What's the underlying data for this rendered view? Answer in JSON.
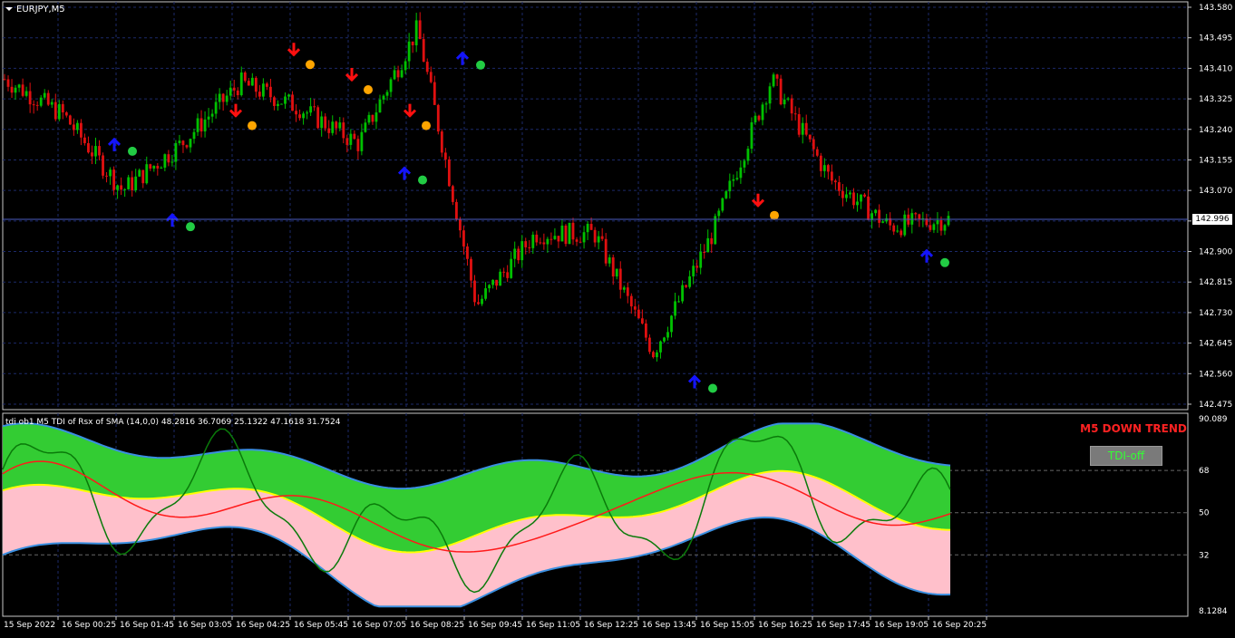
{
  "main_chart": {
    "symbol_label": "EURJPY,M5",
    "current_price": "142.996",
    "price_axis": [
      "143.580",
      "143.495",
      "143.410",
      "143.325",
      "143.240",
      "143.155",
      "143.070",
      "142.985",
      "142.900",
      "142.815",
      "142.730",
      "142.645",
      "142.560",
      "142.475"
    ],
    "colors": {
      "bull": "#00c000",
      "bear": "#e01010",
      "up_arrow": "#1414ff",
      "down_arrow": "#ff1010",
      "dot_green": "#22cc44",
      "dot_orange": "#ffa500",
      "grid": "#1c2a6a"
    }
  },
  "indicator": {
    "title": "tdi ob1 M5 TDI of Rsx of SMA (14,0,0) 48.2816 36.7069 25.1322 47.1618 31.7524",
    "axis_labels": [
      "90.089",
      "68",
      "50",
      "32",
      "8.1284"
    ],
    "trend_text": "M5 DOWN TREND",
    "toggle_button": "TDI-off",
    "colors": {
      "upper_fill": "#33cc33",
      "lower_fill": "#ffc0cb",
      "band_edge": "#3a8fe0",
      "mid": "#ffff00",
      "fast": "#0a7a0a",
      "slow": "#ff1a1a"
    }
  },
  "time_axis": [
    "15 Sep 2022",
    "16 Sep 00:25",
    "16 Sep 01:45",
    "16 Sep 03:05",
    "16 Sep 04:25",
    "16 Sep 05:45",
    "16 Sep 07:05",
    "16 Sep 08:25",
    "16 Sep 09:45",
    "16 Sep 11:05",
    "16 Sep 12:25",
    "16 Sep 13:45",
    "16 Sep 15:05",
    "16 Sep 16:25",
    "16 Sep 17:45",
    "16 Sep 19:05",
    "16 Sep 20:25"
  ],
  "chart_data": {
    "type": "line",
    "title": "EURJPY,M5",
    "ylim": [
      142.475,
      143.58
    ],
    "x": [
      "15 Sep 2022",
      "16 Sep 00:25",
      "16 Sep 01:45",
      "16 Sep 03:05",
      "16 Sep 04:25",
      "16 Sep 05:45",
      "16 Sep 07:05",
      "16 Sep 08:25",
      "16 Sep 09:45",
      "16 Sep 11:05",
      "16 Sep 12:25",
      "16 Sep 13:45",
      "16 Sep 15:05",
      "16 Sep 16:25",
      "16 Sep 17:45",
      "16 Sep 19:05",
      "16 Sep 20:25"
    ],
    "series": [
      {
        "values": [
          143.38,
          143.28,
          143.07,
          143.2,
          143.37,
          143.3,
          143.2,
          143.52,
          142.75,
          142.95,
          142.95,
          142.62,
          142.95,
          143.38,
          143.1,
          142.97,
          142.99
        ]
      }
    ],
    "signals": {
      "up_arrows": [
        "16 Sep 00:25",
        "16 Sep 01:45",
        "16 Sep 07:05",
        "16 Sep 08:25",
        "16 Sep 13:45",
        "16 Sep 19:05"
      ],
      "down_arrows": [
        "16 Sep 03:05",
        "16 Sep 04:25",
        "16 Sep 05:45",
        "16 Sep 07:05",
        "16 Sep 15:05"
      ]
    }
  }
}
